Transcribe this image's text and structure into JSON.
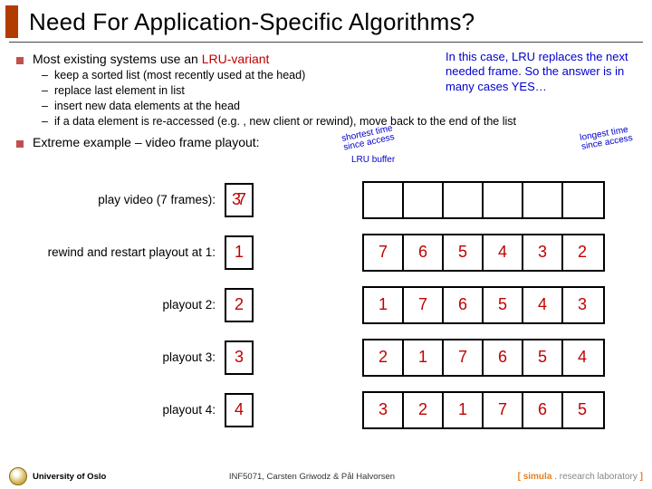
{
  "title": "Need For Application-Specific Algorithms?",
  "point1": {
    "lead": "Most existing systems use an ",
    "lru": "LRU-variant",
    "subs": [
      "keep a sorted list (most recently used at the head)",
      "replace last element in list",
      "insert new data elements at the head",
      "if a data element is re-accessed (e.g. , new client or rewind), move back to the end of the list"
    ]
  },
  "sidenote": "In this case, LRU replaces the next needed frame. So the answer is in many cases YES…",
  "point2": "Extreme example – video frame playout:",
  "annot_left_l1": "shortest time",
  "annot_left_l2": "since access",
  "annot_right_l1": "longest time",
  "annot_right_l2": "since access",
  "buffer_label": "LRU buffer",
  "rows": [
    {
      "label": "play video (7 frames):",
      "box": "7",
      "overlay": "3",
      "cells": [
        "",
        "",
        "",
        "",
        "",
        ""
      ]
    },
    {
      "label": "rewind and restart playout at 1:",
      "box": "1",
      "cells": [
        "7",
        "6",
        "5",
        "4",
        "3",
        "2"
      ]
    },
    {
      "label": "playout 2:",
      "box": "2",
      "cells": [
        "1",
        "7",
        "6",
        "5",
        "4",
        "3"
      ]
    },
    {
      "label": "playout 3:",
      "box": "3",
      "cells": [
        "2",
        "1",
        "7",
        "6",
        "5",
        "4"
      ]
    },
    {
      "label": "playout 4:",
      "box": "4",
      "cells": [
        "3",
        "2",
        "1",
        "7",
        "6",
        "5"
      ]
    }
  ],
  "footer": {
    "left": "University of Oslo",
    "center": "INF5071, Carsten Griwodz & Pål Halvorsen",
    "right_bracket_l": "[ ",
    "right_simula": "simula",
    "right_dot": " . ",
    "right_rest": "research laboratory",
    "right_bracket_r": " ]"
  }
}
